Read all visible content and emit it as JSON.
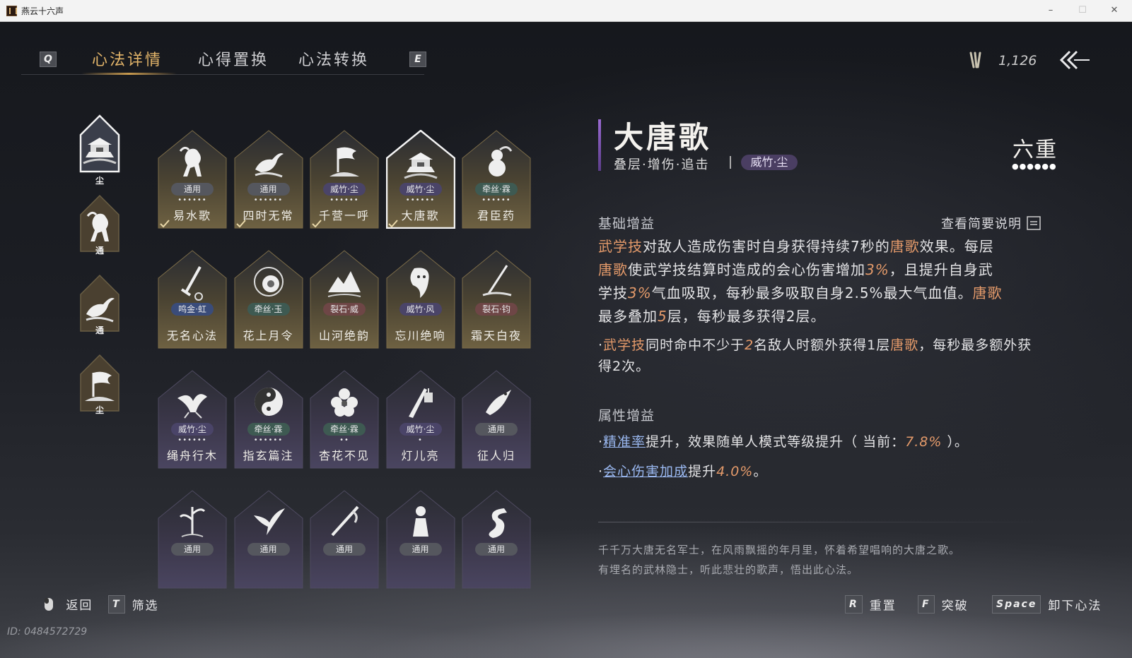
{
  "window": {
    "title": "燕云十六声",
    "minimize": "–",
    "maximize": "☐",
    "close": "✕"
  },
  "tabs": {
    "left_key": "Q",
    "right_key": "E",
    "items": [
      {
        "label": "心法详情",
        "active": true
      },
      {
        "label": "心得置换",
        "active": false
      },
      {
        "label": "心法转换",
        "active": false
      }
    ]
  },
  "currency": {
    "icon": "feather-icon",
    "value": "1,126"
  },
  "sidebar": [
    {
      "tag": "尘",
      "art": "palace-icon",
      "selected": true
    },
    {
      "tag": "通",
      "art": "horse-icon",
      "selected": false
    },
    {
      "tag": "通",
      "art": "bird-icon",
      "selected": false
    },
    {
      "tag": "尘",
      "art": "flag-icon",
      "selected": false
    }
  ],
  "cards": [
    {
      "name": "易水歌",
      "sect": "通用",
      "dots": "••••••",
      "art": "horse-icon",
      "checked": true,
      "tone": "gold"
    },
    {
      "name": "四时无常",
      "sect": "通用",
      "dots": "••••••",
      "art": "bird-icon",
      "checked": true,
      "tone": "gold"
    },
    {
      "name": "千营一呼",
      "sect": "威竹·尘",
      "dots": "••••••",
      "art": "flag-icon",
      "checked": true,
      "tone": "gold"
    },
    {
      "name": "大唐歌",
      "sect": "威竹·尘",
      "dots": "••••••",
      "art": "palace-icon",
      "checked": true,
      "tone": "gold",
      "selected": true
    },
    {
      "name": "君臣药",
      "sect": "牵丝·霖",
      "dots": "••••••",
      "art": "gourd-icon",
      "checked": false,
      "tone": "gold"
    },
    {
      "name": "无名心法",
      "sect": "鸣金·虹",
      "dots": "",
      "art": "sword-icon",
      "checked": false,
      "tone": "gold"
    },
    {
      "name": "花上月令",
      "sect": "牵丝·玉",
      "dots": "",
      "art": "flower-ring-icon",
      "checked": false,
      "tone": "gold"
    },
    {
      "name": "山河绝韵",
      "sect": "裂石·威",
      "dots": "",
      "art": "mountain-icon",
      "checked": false,
      "tone": "gold"
    },
    {
      "name": "忘川绝响",
      "sect": "威竹·风",
      "dots": "",
      "art": "ghost-icon",
      "checked": false,
      "tone": "gold"
    },
    {
      "name": "霜天白夜",
      "sect": "裂石·钧",
      "dots": "",
      "art": "blade-icon",
      "checked": false,
      "tone": "gold"
    },
    {
      "name": "绳舟行木",
      "sect": "威竹·尘",
      "dots": "••••••",
      "art": "tree-icon",
      "checked": false,
      "tone": "purple"
    },
    {
      "name": "指玄篇注",
      "sect": "牵丝·霖",
      "dots": "••••••",
      "art": "yinyang-icon",
      "checked": false,
      "tone": "purple"
    },
    {
      "name": "杏花不见",
      "sect": "牵丝·霖",
      "dots": "••",
      "art": "blossom-icon",
      "checked": false,
      "tone": "purple"
    },
    {
      "name": "灯儿亮",
      "sect": "威竹·尘",
      "dots": "•",
      "art": "lantern-icon",
      "checked": false,
      "tone": "purple"
    },
    {
      "name": "征人归",
      "sect": "通用",
      "dots": "",
      "art": "crow-icon",
      "checked": false,
      "tone": "purple"
    },
    {
      "name": "",
      "sect": "通用",
      "dots": "",
      "art": "bamboo-icon",
      "checked": false,
      "tone": "purple"
    },
    {
      "name": "",
      "sect": "通用",
      "dots": "",
      "art": "swallow-icon",
      "checked": false,
      "tone": "purple"
    },
    {
      "name": "",
      "sect": "通用",
      "dots": "",
      "art": "spear-icon",
      "checked": false,
      "tone": "purple"
    },
    {
      "name": "",
      "sect": "通用",
      "dots": "",
      "art": "figure-icon",
      "checked": false,
      "tone": "purple"
    },
    {
      "name": "",
      "sect": "通用",
      "dots": "",
      "art": "dragon-icon",
      "checked": false,
      "tone": "purple"
    }
  ],
  "detail": {
    "title": "大唐歌",
    "tags": "叠层·增伤·追击",
    "sect": "威竹·尘",
    "rank": "六重",
    "rank_dots": "●●●●●●",
    "base_title": "基础增益",
    "summary_link": "查看简要说明",
    "base_lines": [
      [
        {
          "t": "武学技",
          "c": "kw"
        },
        {
          "t": "对敌人造成伤害时自身获得持续7秒的"
        },
        {
          "t": "唐歌",
          "c": "kw"
        },
        {
          "t": "效果。每层"
        }
      ],
      [
        {
          "t": "唐歌",
          "c": "kw"
        },
        {
          "t": "使武学技结算时造成的会心伤害增加"
        },
        {
          "t": "3%",
          "c": "num"
        },
        {
          "t": "，且提升自身武"
        }
      ],
      [
        {
          "t": "学技"
        },
        {
          "t": "3%",
          "c": "num"
        },
        {
          "t": "气血吸取，每秒最多吸取自身2.5%最大气血值。"
        },
        {
          "t": "唐歌",
          "c": "kw"
        }
      ],
      [
        {
          "t": "最多叠加"
        },
        {
          "t": "5",
          "c": "num"
        },
        {
          "t": "层，每秒最多获得2层。"
        }
      ]
    ],
    "extra_lines": [
      [
        {
          "t": "·"
        },
        {
          "t": "武学技",
          "c": "kw"
        },
        {
          "t": "同时命中不少于"
        },
        {
          "t": "2",
          "c": "num"
        },
        {
          "t": "名敌人时额外获得1层"
        },
        {
          "t": "唐歌",
          "c": "kw"
        },
        {
          "t": "，每秒最多额外获"
        }
      ],
      [
        {
          "t": "得2次。"
        }
      ]
    ],
    "attr_title": "属性增益",
    "attr_lines": [
      [
        {
          "t": "·"
        },
        {
          "t": "精准率",
          "c": "link"
        },
        {
          "t": "提升，效果随单人模式等级提升（ 当前："
        },
        {
          "t": "7.8%",
          "c": "num"
        },
        {
          "t": " ）。"
        }
      ],
      [
        {
          "t": "·"
        },
        {
          "t": "会心伤害加成",
          "c": "link"
        },
        {
          "t": "提升"
        },
        {
          "t": "4.0%",
          "c": "num"
        },
        {
          "t": "。"
        }
      ]
    ],
    "lore": [
      "千千万大唐无名军士，在风雨飘摇的年月里，怀着希望唱响的大唐之歌。",
      "有埋名的武林隐士，听此悲壮的歌声，悟出此心法。"
    ]
  },
  "footer": {
    "back": {
      "label": "返回",
      "icon": "mouse-icon"
    },
    "filter": {
      "key": "T",
      "label": "筛选"
    },
    "reset": {
      "key": "R",
      "label": "重置"
    },
    "breakthrough": {
      "key": "F",
      "label": "突破"
    },
    "unequip": {
      "key": "Space",
      "label": "卸下心法"
    }
  },
  "uid": "ID: 0484572729"
}
